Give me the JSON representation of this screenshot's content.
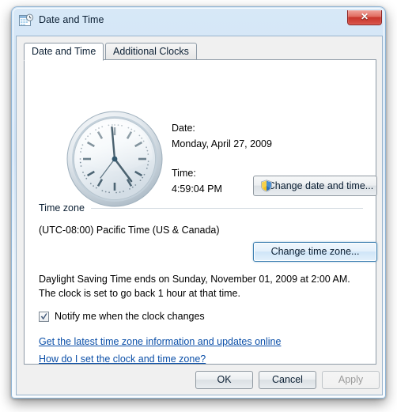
{
  "window": {
    "title": "Date and Time",
    "icon": "calendar-clock-icon",
    "close_label": "✕"
  },
  "tabs": [
    {
      "label": "Date and Time",
      "active": true
    },
    {
      "label": "Additional Clocks",
      "active": false
    }
  ],
  "clock": {
    "icon": "analog-clock",
    "hour": 4,
    "minute": 59,
    "second": 4
  },
  "date_time": {
    "date_label": "Date:",
    "date_value": "Monday, April 27, 2009",
    "time_label": "Time:",
    "time_value": "4:59:04 PM"
  },
  "buttons": {
    "change_date_time": "Change date and time...",
    "change_time_zone": "Change time zone...",
    "ok": "OK",
    "cancel": "Cancel",
    "apply": "Apply"
  },
  "time_zone": {
    "group_label": "Time zone",
    "value": "(UTC-08:00) Pacific Time (US & Canada)"
  },
  "dst": {
    "text": "Daylight Saving Time ends on Sunday, November 01, 2009 at 2:00 AM. The clock is set to go back 1 hour at that time."
  },
  "notify": {
    "label": "Notify me when the clock changes",
    "checked": true
  },
  "links": [
    {
      "label": "Get the latest time zone information and updates online"
    },
    {
      "label": "How do I set the clock and time zone?"
    }
  ],
  "colors": {
    "frame": "#cfe2f5",
    "client": "#f0f0f0",
    "panel": "#ffffff",
    "link": "#0b4fa8",
    "close": "#c8362c",
    "focus": "#3c7fb1"
  }
}
